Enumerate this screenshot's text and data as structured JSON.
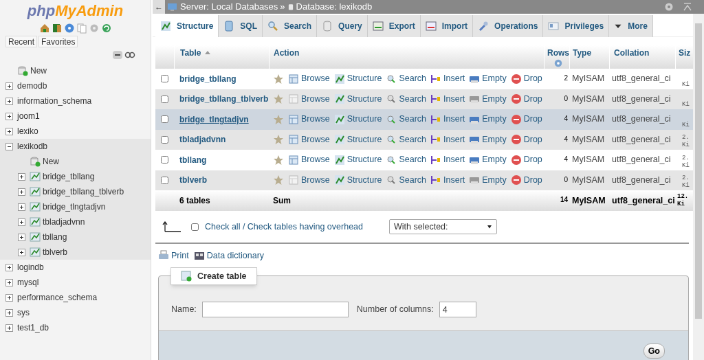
{
  "logo": {
    "part_1": "php",
    "part_2": "MyAdmin"
  },
  "sidebar_tabs": [
    {
      "label": "Recent"
    },
    {
      "label": "Favorites"
    }
  ],
  "tree": [
    {
      "label": "New",
      "kind": "new"
    },
    {
      "label": "demodb",
      "kind": "db",
      "expanded": false
    },
    {
      "label": "information_schema",
      "kind": "db",
      "expanded": false
    },
    {
      "label": "joom1",
      "kind": "db",
      "expanded": false
    },
    {
      "label": "lexiko",
      "kind": "db",
      "expanded": false
    },
    {
      "label": "lexikodb",
      "kind": "db",
      "expanded": true,
      "children": [
        {
          "label": "New",
          "kind": "new"
        },
        {
          "label": "bridge_tbllang",
          "kind": "table",
          "expanded": false
        },
        {
          "label": "bridge_tbllang_tblverb",
          "kind": "table",
          "expanded": false
        },
        {
          "label": "bridge_tlngtadjvn",
          "kind": "table",
          "expanded": false
        },
        {
          "label": "tbladjadvnn",
          "kind": "table",
          "expanded": false
        },
        {
          "label": "tbllang",
          "kind": "table",
          "expanded": false
        },
        {
          "label": "tblverb",
          "kind": "table",
          "expanded": false
        }
      ]
    },
    {
      "label": "logindb",
      "kind": "db",
      "expanded": false
    },
    {
      "label": "mysql",
      "kind": "db",
      "expanded": false
    },
    {
      "label": "performance_schema",
      "kind": "db",
      "expanded": false
    },
    {
      "label": "sys",
      "kind": "db",
      "expanded": false
    },
    {
      "label": "test1_db",
      "kind": "db",
      "expanded": false
    }
  ],
  "breadcrumb": {
    "back": "←",
    "server": "Server: Local Databases",
    "separator": "»",
    "database": "Database: lexikodb"
  },
  "tabs": [
    {
      "label": "Structure",
      "kind": "structure",
      "selected": true
    },
    {
      "label": "SQL",
      "kind": "sql",
      "selected": false
    },
    {
      "label": "Search",
      "kind": "search",
      "selected": false
    },
    {
      "label": "Query",
      "kind": "query",
      "selected": false
    },
    {
      "label": "Export",
      "kind": "export",
      "selected": false
    },
    {
      "label": "Import",
      "kind": "import",
      "selected": false
    },
    {
      "label": "Operations",
      "kind": "operations",
      "selected": false
    },
    {
      "label": "Privileges",
      "kind": "privileges",
      "selected": false
    },
    {
      "label": "More",
      "kind": "more",
      "selected": false
    }
  ],
  "columns": {
    "table": "Table",
    "action": "Action",
    "rows": "Rows",
    "type": "Type",
    "collation": "Collation",
    "size": "Siz"
  },
  "rows": [
    {
      "name": "bridge_tbllang",
      "actions": [
        "Browse",
        "Structure",
        "Search",
        "Insert",
        "Empty",
        "Drop"
      ],
      "rows": "2",
      "type": "MyISAM",
      "collation": "utf8_general_ci",
      "size": [
        "Ki"
      ],
      "empty": false,
      "highlighted": false
    },
    {
      "name": "bridge_tbllang_tblverb",
      "actions": [
        "Browse",
        "Structure",
        "Search",
        "Insert",
        "Empty",
        "Drop"
      ],
      "rows": "0",
      "type": "MyISAM",
      "collation": "utf8_general_ci",
      "size": [
        "Ki"
      ],
      "empty": true,
      "highlighted": false
    },
    {
      "name": "bridge_tlngtadjvn",
      "actions": [
        "Browse",
        "Structure",
        "Search",
        "Insert",
        "Empty",
        "Drop"
      ],
      "rows": "4",
      "type": "MyISAM",
      "collation": "utf8_general_ci",
      "size": [
        "Ki"
      ],
      "empty": false,
      "highlighted": true
    },
    {
      "name": "tbladjadvnn",
      "actions": [
        "Browse",
        "Structure",
        "Search",
        "Insert",
        "Empty",
        "Drop"
      ],
      "rows": "4",
      "type": "MyISAM",
      "collation": "utf8_general_ci",
      "size": [
        "2.",
        "Ki"
      ],
      "empty": false,
      "highlighted": false
    },
    {
      "name": "tbllang",
      "actions": [
        "Browse",
        "Structure",
        "Search",
        "Insert",
        "Empty",
        "Drop"
      ],
      "rows": "4",
      "type": "MyISAM",
      "collation": "utf8_general_ci",
      "size": [
        "2.",
        "Ki"
      ],
      "empty": false,
      "highlighted": false
    },
    {
      "name": "tblverb",
      "actions": [
        "Browse",
        "Structure",
        "Search",
        "Insert",
        "Empty",
        "Drop"
      ],
      "rows": "0",
      "type": "MyISAM",
      "collation": "utf8_general_ci",
      "size": [
        "2.",
        "Ki"
      ],
      "empty": true,
      "highlighted": false
    }
  ],
  "summary": {
    "label": "6 tables",
    "action": "Sum",
    "rows": "14",
    "type": "MyISAM",
    "collation": "utf8_general_ci",
    "size": [
      "12.",
      "Ki"
    ]
  },
  "check_all": {
    "label": "Check all / Check tables having overhead",
    "checked": false
  },
  "with_selected": "With selected:",
  "links": {
    "print": "Print",
    "data_dictionary": "Data dictionary"
  },
  "create_table": {
    "legend": "Create table",
    "name_label": "Name:",
    "columns_label": "Number of columns:",
    "columns_value": "4",
    "go": "Go"
  }
}
